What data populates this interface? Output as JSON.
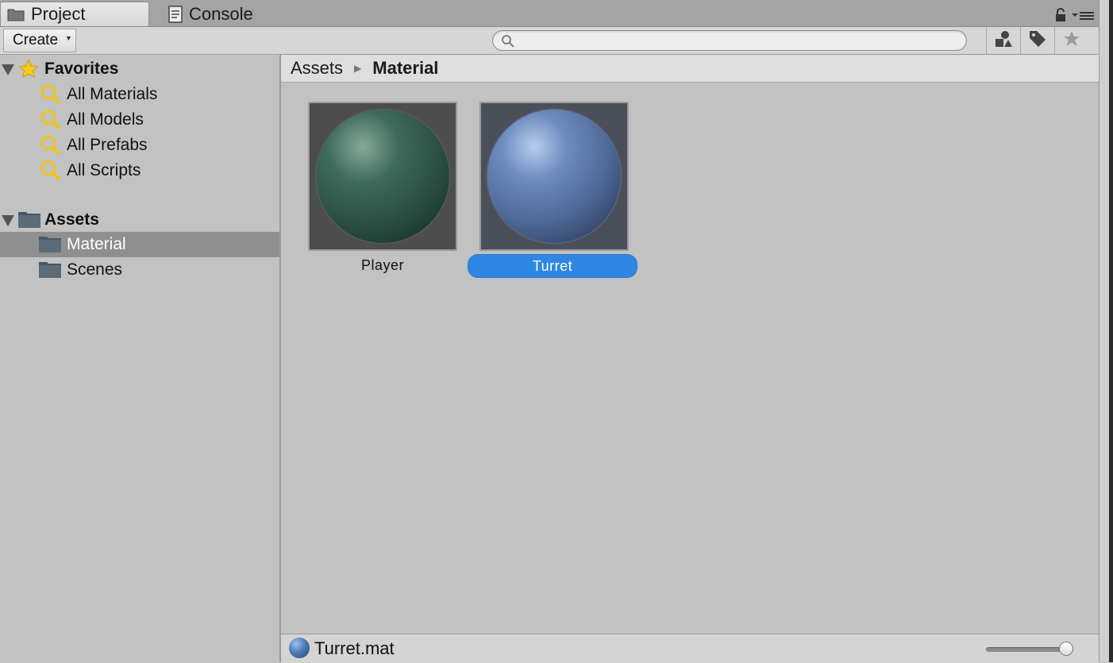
{
  "tabs": [
    {
      "label": "Project",
      "icon": "folder-icon",
      "active": true
    },
    {
      "label": "Console",
      "icon": "console-icon",
      "active": false
    }
  ],
  "toolbar": {
    "create_label": "Create",
    "search_value": "",
    "search_placeholder": ""
  },
  "tree": {
    "favorites": {
      "label": "Favorites",
      "items": [
        "All Materials",
        "All Models",
        "All Prefabs",
        "All Scripts"
      ]
    },
    "assets": {
      "label": "Assets",
      "items": [
        "Material",
        "Scenes"
      ],
      "selected": "Material"
    }
  },
  "breadcrumb": [
    "Assets",
    "Material"
  ],
  "assets": [
    {
      "name": "Player",
      "color": "#2f5f4f",
      "selected": false
    },
    {
      "name": "Turret",
      "color": "#4f6fa4",
      "selected": true
    }
  ],
  "footer": {
    "filename": "Turret.mat",
    "thumbnail_size": 0.92
  },
  "colors": {
    "selection": "#2e87e3",
    "tree_selection": "#8f8f8f"
  }
}
